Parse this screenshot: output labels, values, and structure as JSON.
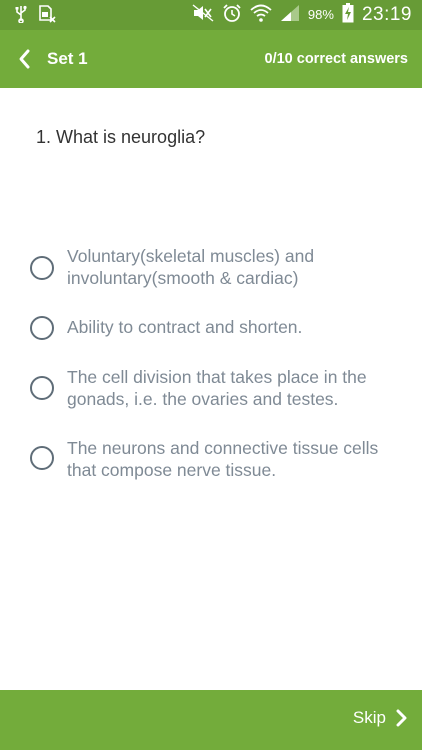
{
  "status_bar": {
    "battery_percent": "98%",
    "time": "23:19",
    "icons": [
      "usb-icon",
      "sim-card-icon",
      "mute-icon",
      "alarm-icon",
      "wifi-icon",
      "signal-icon",
      "battery-charging-icon"
    ]
  },
  "app_bar": {
    "title": "Set 1",
    "score": "0/10 correct answers"
  },
  "question": {
    "text": "1. What is neuroglia?"
  },
  "options": [
    {
      "text": "Voluntary(skeletal muscles) and involuntary(smooth & cardiac)",
      "selected": false
    },
    {
      "text": "Ability to contract and shorten.",
      "selected": false
    },
    {
      "text": "The cell division that takes place in the gonads, i.e. the ovaries and testes.",
      "selected": false
    },
    {
      "text": "The neurons and connective tissue cells that compose nerve tissue.",
      "selected": false
    }
  ],
  "bottom_bar": {
    "skip_label": "Skip"
  },
  "colors": {
    "status_bar": "#679b36",
    "app_bar": "#73ac3b",
    "radio_border": "#5f6d78",
    "option_text": "#7f8a95"
  }
}
